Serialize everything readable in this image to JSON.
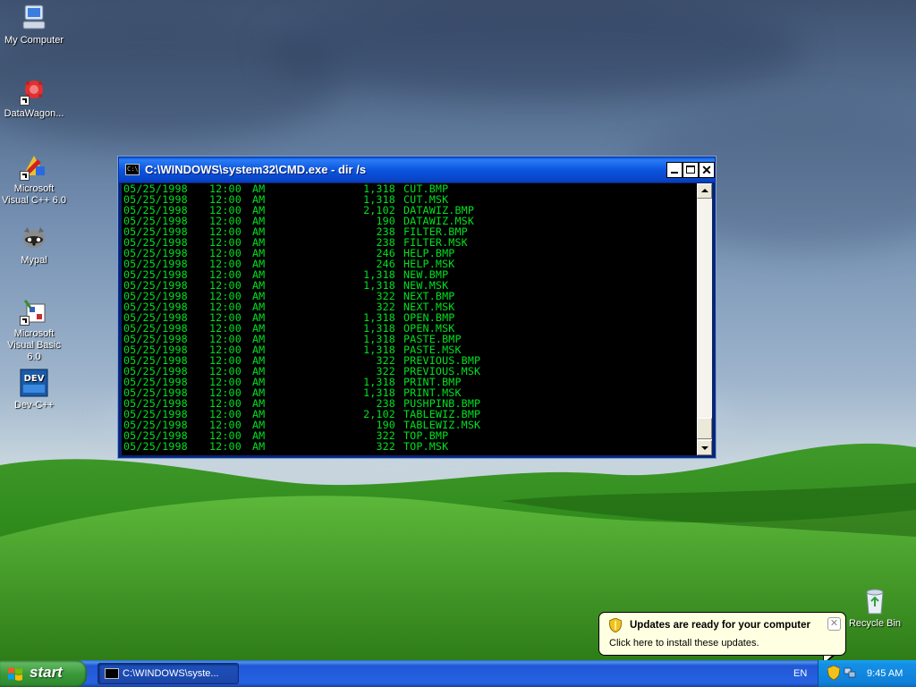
{
  "desktop": {
    "icons": [
      {
        "label": "My Computer"
      },
      {
        "label": "DataWagon..."
      },
      {
        "label": "Microsoft Visual C++ 6.0"
      },
      {
        "label": "Mypal"
      },
      {
        "label": "Microsoft Visual Basic 6.0"
      },
      {
        "label": "Dev-C++"
      }
    ],
    "recycle_bin": {
      "label": "Recycle Bin"
    }
  },
  "cmd_window": {
    "title": "C:\\WINDOWS\\system32\\CMD.exe - dir /s",
    "icon_text": "C:\\",
    "close_glyph": "✕",
    "text_color": "#00e020",
    "lines": [
      {
        "date": "05/25/1998",
        "time": "12:00",
        "ampm": "AM",
        "size": "1,318",
        "name": "CUT.BMP"
      },
      {
        "date": "05/25/1998",
        "time": "12:00",
        "ampm": "AM",
        "size": "1,318",
        "name": "CUT.MSK"
      },
      {
        "date": "05/25/1998",
        "time": "12:00",
        "ampm": "AM",
        "size": "2,102",
        "name": "DATAWIZ.BMP"
      },
      {
        "date": "05/25/1998",
        "time": "12:00",
        "ampm": "AM",
        "size": "190",
        "name": "DATAWIZ.MSK"
      },
      {
        "date": "05/25/1998",
        "time": "12:00",
        "ampm": "AM",
        "size": "238",
        "name": "FILTER.BMP"
      },
      {
        "date": "05/25/1998",
        "time": "12:00",
        "ampm": "AM",
        "size": "238",
        "name": "FILTER.MSK"
      },
      {
        "date": "05/25/1998",
        "time": "12:00",
        "ampm": "AM",
        "size": "246",
        "name": "HELP.BMP"
      },
      {
        "date": "05/25/1998",
        "time": "12:00",
        "ampm": "AM",
        "size": "246",
        "name": "HELP.MSK"
      },
      {
        "date": "05/25/1998",
        "time": "12:00",
        "ampm": "AM",
        "size": "1,318",
        "name": "NEW.BMP"
      },
      {
        "date": "05/25/1998",
        "time": "12:00",
        "ampm": "AM",
        "size": "1,318",
        "name": "NEW.MSK"
      },
      {
        "date": "05/25/1998",
        "time": "12:00",
        "ampm": "AM",
        "size": "322",
        "name": "NEXT.BMP"
      },
      {
        "date": "05/25/1998",
        "time": "12:00",
        "ampm": "AM",
        "size": "322",
        "name": "NEXT.MSK"
      },
      {
        "date": "05/25/1998",
        "time": "12:00",
        "ampm": "AM",
        "size": "1,318",
        "name": "OPEN.BMP"
      },
      {
        "date": "05/25/1998",
        "time": "12:00",
        "ampm": "AM",
        "size": "1,318",
        "name": "OPEN.MSK"
      },
      {
        "date": "05/25/1998",
        "time": "12:00",
        "ampm": "AM",
        "size": "1,318",
        "name": "PASTE.BMP"
      },
      {
        "date": "05/25/1998",
        "time": "12:00",
        "ampm": "AM",
        "size": "1,318",
        "name": "PASTE.MSK"
      },
      {
        "date": "05/25/1998",
        "time": "12:00",
        "ampm": "AM",
        "size": "322",
        "name": "PREVIOUS.BMP"
      },
      {
        "date": "05/25/1998",
        "time": "12:00",
        "ampm": "AM",
        "size": "322",
        "name": "PREVIOUS.MSK"
      },
      {
        "date": "05/25/1998",
        "time": "12:00",
        "ampm": "AM",
        "size": "1,318",
        "name": "PRINT.BMP"
      },
      {
        "date": "05/25/1998",
        "time": "12:00",
        "ampm": "AM",
        "size": "1,318",
        "name": "PRINT.MSK"
      },
      {
        "date": "05/25/1998",
        "time": "12:00",
        "ampm": "AM",
        "size": "238",
        "name": "PUSHPINB.BMP"
      },
      {
        "date": "05/25/1998",
        "time": "12:00",
        "ampm": "AM",
        "size": "2,102",
        "name": "TABLEWIZ.BMP"
      },
      {
        "date": "05/25/1998",
        "time": "12:00",
        "ampm": "AM",
        "size": "190",
        "name": "TABLEWIZ.MSK"
      },
      {
        "date": "05/25/1998",
        "time": "12:00",
        "ampm": "AM",
        "size": "322",
        "name": "TOP.BMP"
      },
      {
        "date": "05/25/1998",
        "time": "12:00",
        "ampm": "AM",
        "size": "322",
        "name": "TOP.MSK"
      }
    ]
  },
  "balloon": {
    "title": "Updates are ready for your computer",
    "text": "Click here to install these updates.",
    "close_glyph": "✕"
  },
  "taskbar": {
    "start_label": "start",
    "task_label": "C:\\WINDOWS\\syste...",
    "language": "EN",
    "clock": "9:45 AM"
  }
}
